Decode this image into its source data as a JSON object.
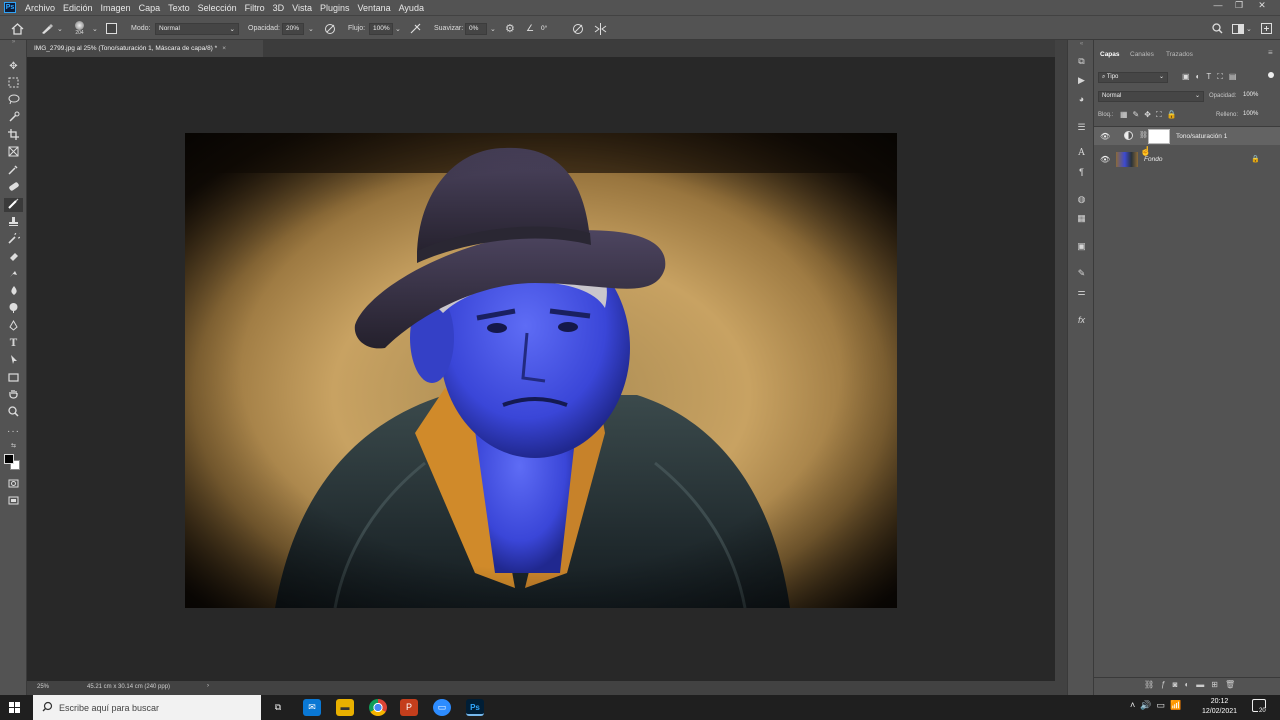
{
  "app": {
    "logo": "Ps"
  },
  "menu": [
    "Archivo",
    "Edición",
    "Imagen",
    "Capa",
    "Texto",
    "Selección",
    "Filtro",
    "3D",
    "Vista",
    "Plugins",
    "Ventana",
    "Ayuda"
  ],
  "window_controls": {
    "minimize": "—",
    "restore": "❐",
    "close": "✕"
  },
  "options": {
    "brush_size": "204",
    "mode_label": "Modo:",
    "mode_value": "Normal",
    "opacity_label": "Opacidad:",
    "opacity_value": "20%",
    "flow_label": "Flujo:",
    "flow_value": "100%",
    "smoothing_label": "Suavizar:",
    "smoothing_value": "0%",
    "angle_symbol": "∠",
    "angle_value": "0°"
  },
  "document_tab": {
    "title": "IMG_2799.jpg al 25% (Tono/saturación 1, Máscara de capa/8) *",
    "close": "×"
  },
  "status": {
    "zoom": "25%",
    "doc_size": "45.21 cm x 30.14 cm (240 ppp)",
    "arrow": "›"
  },
  "layers_panel": {
    "tabs": [
      "Capas",
      "Canales",
      "Trazados"
    ],
    "filter_label": "Tipo",
    "blend_mode": "Normal",
    "opacity_label": "Opacidad:",
    "opacity_value": "100%",
    "lock_label": "Bloq.:",
    "fill_label": "Relleno:",
    "fill_value": "100%",
    "layers": [
      {
        "name": "Tono/saturación 1",
        "visible": true,
        "selected": true
      },
      {
        "name": "Fondo",
        "visible": true,
        "locked": true
      }
    ]
  },
  "taskbar": {
    "search_placeholder": "Escribe aquí para buscar",
    "time": "20:12",
    "date": "12/02/2021",
    "notification_count": "20"
  },
  "colors": {
    "ui_panel": "#535353",
    "canvas_bg": "#282828",
    "skin_blue": "#3d4fe0",
    "wall_ochre": "#c9a062",
    "ps_blue": "#31a8ff"
  }
}
